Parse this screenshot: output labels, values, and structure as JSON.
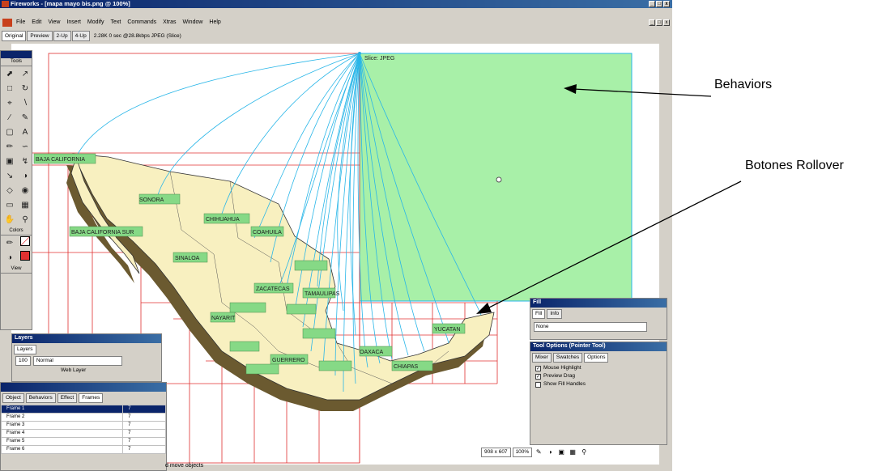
{
  "window": {
    "title": "Fireworks - [mapa mayo bis.png @ 100%]",
    "controls": [
      "_",
      "□",
      "x"
    ]
  },
  "menu": [
    "File",
    "Edit",
    "View",
    "Insert",
    "Modify",
    "Text",
    "Commands",
    "Xtras",
    "Window",
    "Help"
  ],
  "view_tabs": [
    "Original",
    "Preview",
    "2-Up",
    "4-Up"
  ],
  "view_info": "2.28K 0 sec @28.8kbps JPEG (Slice)",
  "slice_label": "Slice: JPEG",
  "states": [
    "SONORA",
    "CHIHUAHUA",
    "BAJA CALIFORNIA",
    "BAJA CALIFORNIA SUR",
    "COAHUILA",
    "SINALOA",
    "ZACATECAS",
    "TAMAULIPAS",
    "NAYARIT",
    "GUERRERO",
    "OAXACA",
    "CHIAPAS",
    "YUCATAN"
  ],
  "tools": {
    "title": "Tools",
    "icons": [
      "arrow-icon",
      "subselect-icon",
      "marquee-icon",
      "lasso-icon",
      "crop-icon",
      "knife-icon",
      "line-icon",
      "pen-icon",
      "rectangle-icon",
      "text-icon",
      "pencil-icon",
      "brush-icon",
      "scale-icon",
      "skew-icon",
      "eyedropper-icon",
      "paintbucket-icon",
      "eraser-icon",
      "rubberstamp-icon",
      "hotspot-icon",
      "slice-icon",
      "hand-icon",
      "zoom-icon"
    ],
    "colors_label": "Colors",
    "view_label": "View"
  },
  "layers": {
    "title": "Layers",
    "tab": "Layers",
    "opacity": "100",
    "blend": "Normal",
    "web_layer": "Web Layer"
  },
  "frames": {
    "tabs": [
      "Object",
      "Behaviors",
      "Effect",
      "Frames"
    ],
    "rows": [
      {
        "name": "Frame 1",
        "delay": "7"
      },
      {
        "name": "Frame 2",
        "delay": "7"
      },
      {
        "name": "Frame 3",
        "delay": "7"
      },
      {
        "name": "Frame 4",
        "delay": "7"
      },
      {
        "name": "Frame 5",
        "delay": "7"
      },
      {
        "name": "Frame 6",
        "delay": "7"
      }
    ]
  },
  "fill_panel": {
    "title": "Fill",
    "tabs": [
      "Fill",
      "Info"
    ],
    "value": "None"
  },
  "tool_options": {
    "title": "Tool Options (Pointer Tool)",
    "tabs": [
      "Mixer",
      "Swatches",
      "Options"
    ],
    "options": [
      {
        "label": "Mouse Highlight",
        "checked": true
      },
      {
        "label": "Preview Drag",
        "checked": true
      },
      {
        "label": "Show Fill Handles",
        "checked": false
      }
    ]
  },
  "status": {
    "text": "d move objects",
    "size": "908 x 607",
    "zoom": "100%"
  },
  "annotations": {
    "behaviors": "Behaviors",
    "rollover": "Botones Rollover"
  },
  "colors": {
    "slice_green": "#a8f0a8",
    "slice_border": "#29b6e8",
    "map_land": "#f8f0c0",
    "guide_red": "#e03030",
    "title_blue": "#0a246a"
  }
}
